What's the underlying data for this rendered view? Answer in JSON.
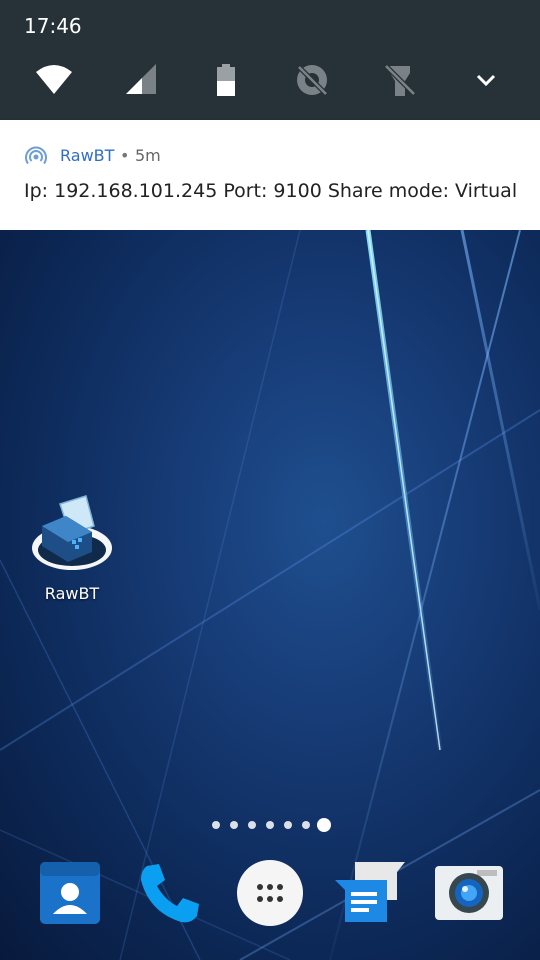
{
  "status": {
    "time": "17:46"
  },
  "quick_settings": {
    "tiles": [
      "wifi-icon",
      "cellular-signal-icon",
      "battery-icon",
      "data-saver-off-icon",
      "flashlight-off-icon",
      "expand-chevron-icon"
    ]
  },
  "notification": {
    "app_name": "RawBT",
    "separator": "•",
    "time": "5m",
    "text": "Ip: 192.168.101.245 Port: 9100 Share mode: Virtual"
  },
  "home": {
    "app_label": "RawBT",
    "page_count": 7,
    "active_page": 7
  },
  "dock": [
    "contacts-icon",
    "phone-icon",
    "all-apps-icon",
    "messages-icon",
    "camera-icon"
  ],
  "colors": {
    "quick_settings_bg": "#263238",
    "notification_accent": "#2f6fc1",
    "phone_blue": "#0b9ff2"
  }
}
